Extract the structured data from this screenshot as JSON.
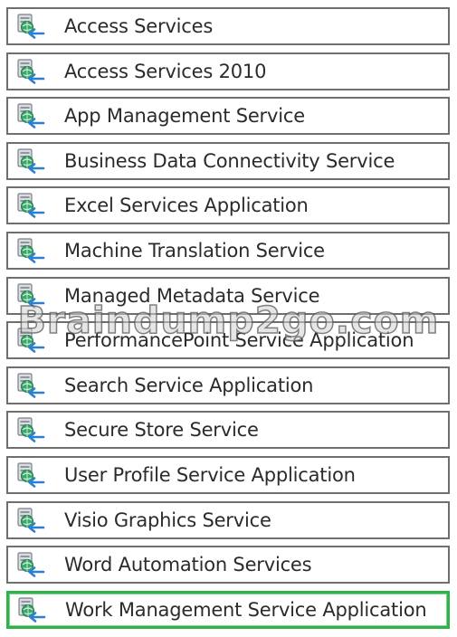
{
  "services": [
    {
      "label": "Access Services",
      "icon": "service-application-icon",
      "selected": false
    },
    {
      "label": "Access Services 2010",
      "icon": "service-application-icon",
      "selected": false
    },
    {
      "label": "App Management Service",
      "icon": "service-application-icon",
      "selected": false
    },
    {
      "label": "Business Data Connectivity Service",
      "icon": "service-application-icon",
      "selected": false
    },
    {
      "label": "Excel Services Application",
      "icon": "service-application-icon",
      "selected": false
    },
    {
      "label": "Machine Translation Service",
      "icon": "service-application-icon",
      "selected": false
    },
    {
      "label": "Managed Metadata Service",
      "icon": "service-application-icon",
      "selected": false
    },
    {
      "label": "PerformancePoint Service Application",
      "icon": "service-application-icon",
      "selected": false
    },
    {
      "label": "Search Service Application",
      "icon": "service-application-icon",
      "selected": false
    },
    {
      "label": "Secure Store Service",
      "icon": "service-application-icon",
      "selected": false
    },
    {
      "label": "User Profile Service Application",
      "icon": "service-application-icon",
      "selected": false
    },
    {
      "label": "Visio Graphics Service",
      "icon": "service-application-icon",
      "selected": false
    },
    {
      "label": "Word Automation Services",
      "icon": "service-application-icon",
      "selected": false
    },
    {
      "label": "Work Management Service Application",
      "icon": "service-application-icon",
      "selected": true
    }
  ],
  "watermark": "Braindump2go.com",
  "colors": {
    "row_border": "#6e6e6e",
    "selected_border": "#2fb24a",
    "text": "#2b2b2b"
  }
}
